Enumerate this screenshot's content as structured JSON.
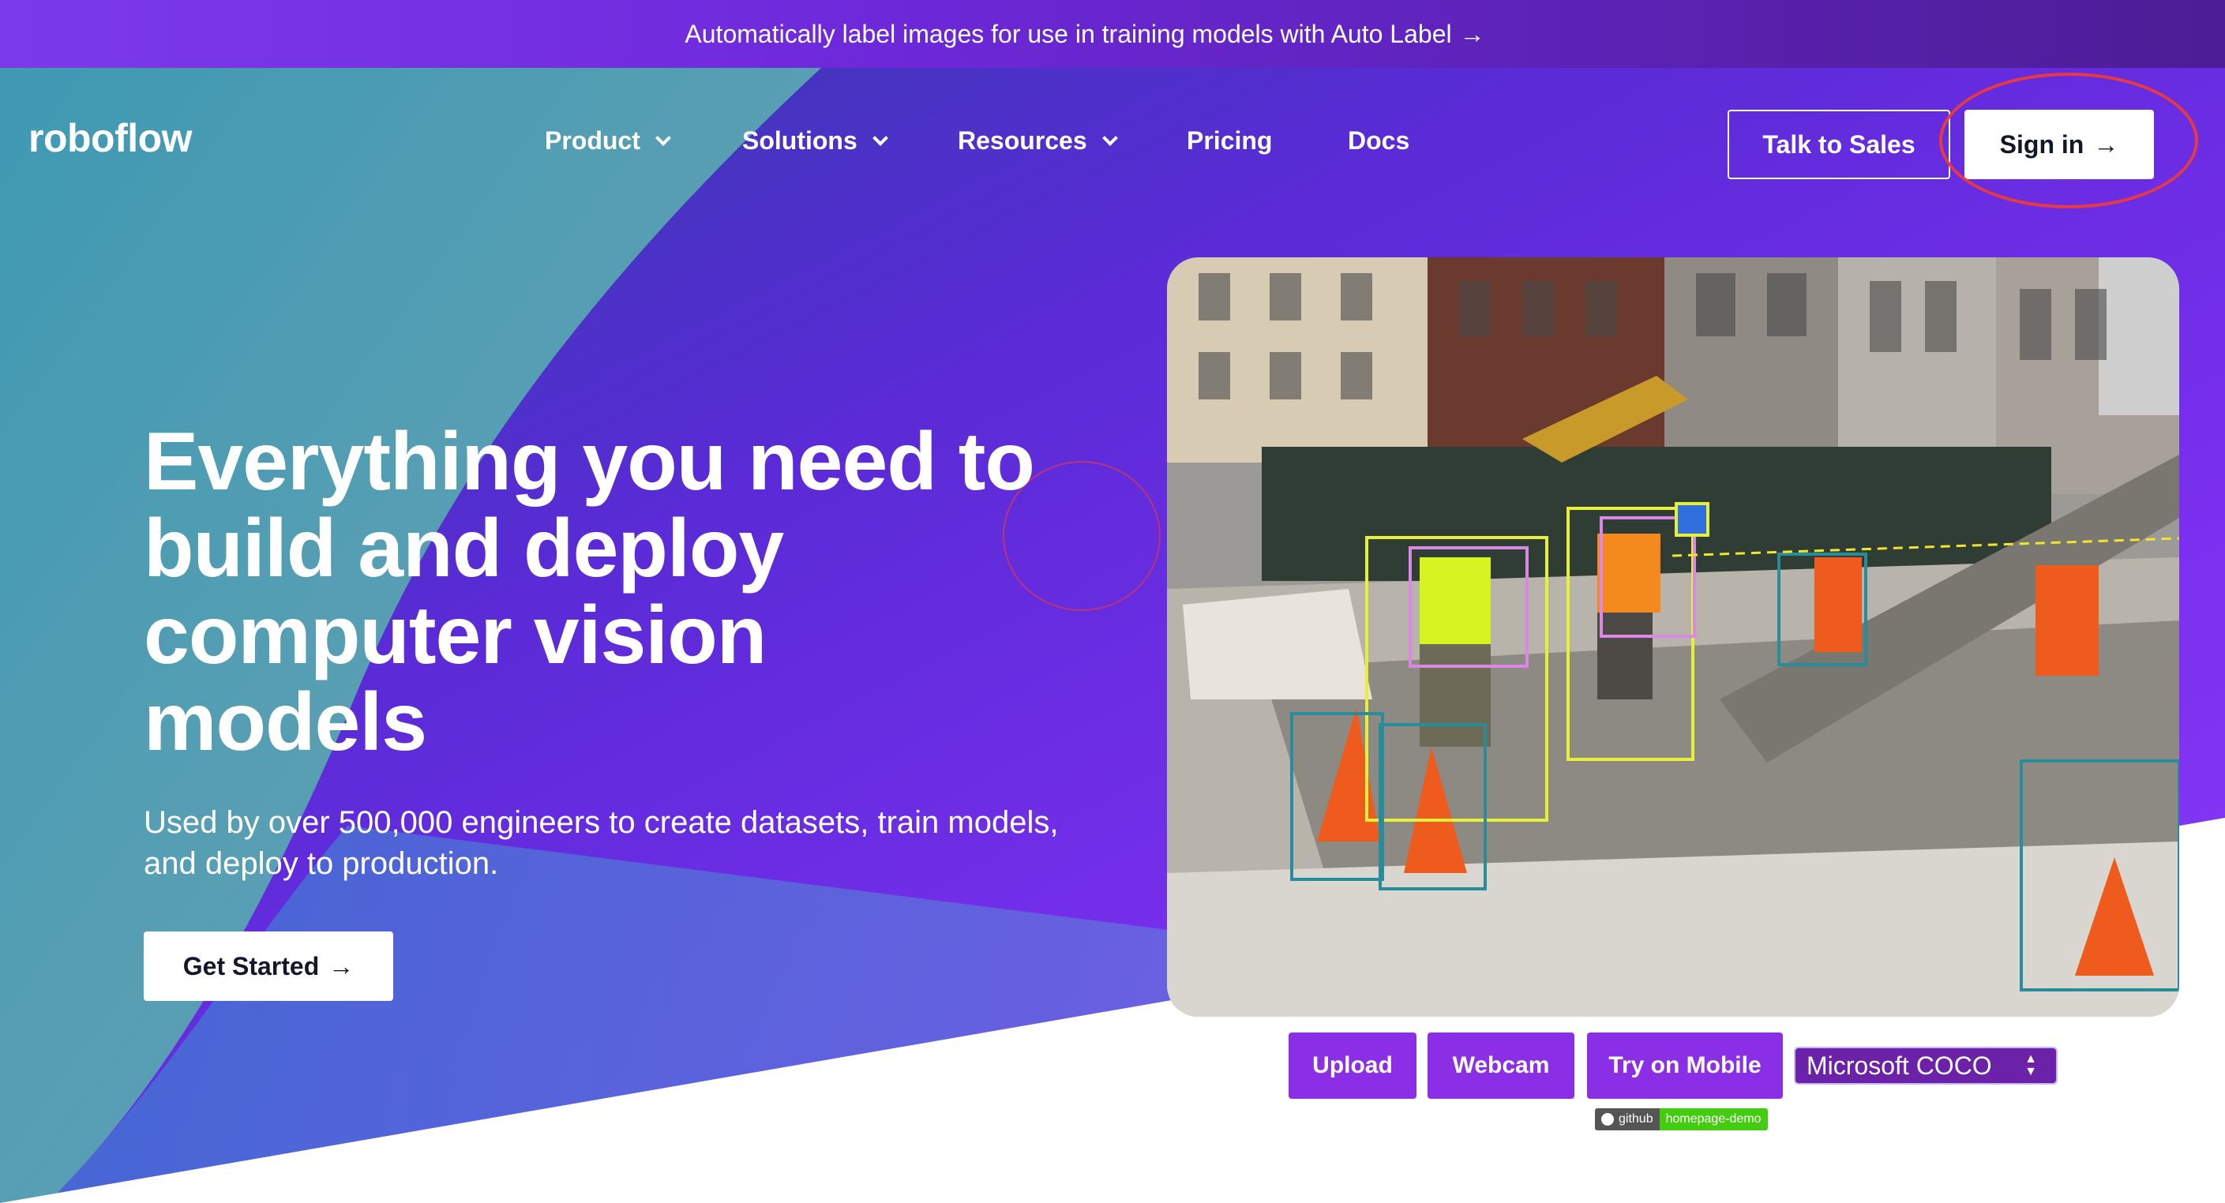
{
  "banner": {
    "text": "Automatically label images for use in training models with Auto Label",
    "arrow": "→"
  },
  "nav": {
    "logo": "roboflow",
    "items": [
      {
        "label": "Product",
        "has_dropdown": true
      },
      {
        "label": "Solutions",
        "has_dropdown": true
      },
      {
        "label": "Resources",
        "has_dropdown": true
      },
      {
        "label": "Pricing",
        "has_dropdown": false
      },
      {
        "label": "Docs",
        "has_dropdown": false
      }
    ],
    "talk_to_sales": "Talk to Sales",
    "sign_in": "Sign in",
    "arrow": "→"
  },
  "hero": {
    "headline": "Everything you need to build and deploy computer vision models",
    "subtext": "Used by over 500,000 engineers to create datasets, train models, and deploy to production.",
    "cta": "Get Started",
    "cta_arrow": "→"
  },
  "demo": {
    "buttons": [
      "Upload",
      "Webcam",
      "Try on Mobile"
    ],
    "model_select": "Microsoft COCO",
    "badge_left": "github",
    "badge_right": "homepage-demo"
  },
  "colors": {
    "banner": "#7c3aed",
    "hero_purple": "#6d28d9",
    "hero_green": "#5eead4",
    "button_purple": "#8b2fe6",
    "annotation_red": "#e53944"
  }
}
